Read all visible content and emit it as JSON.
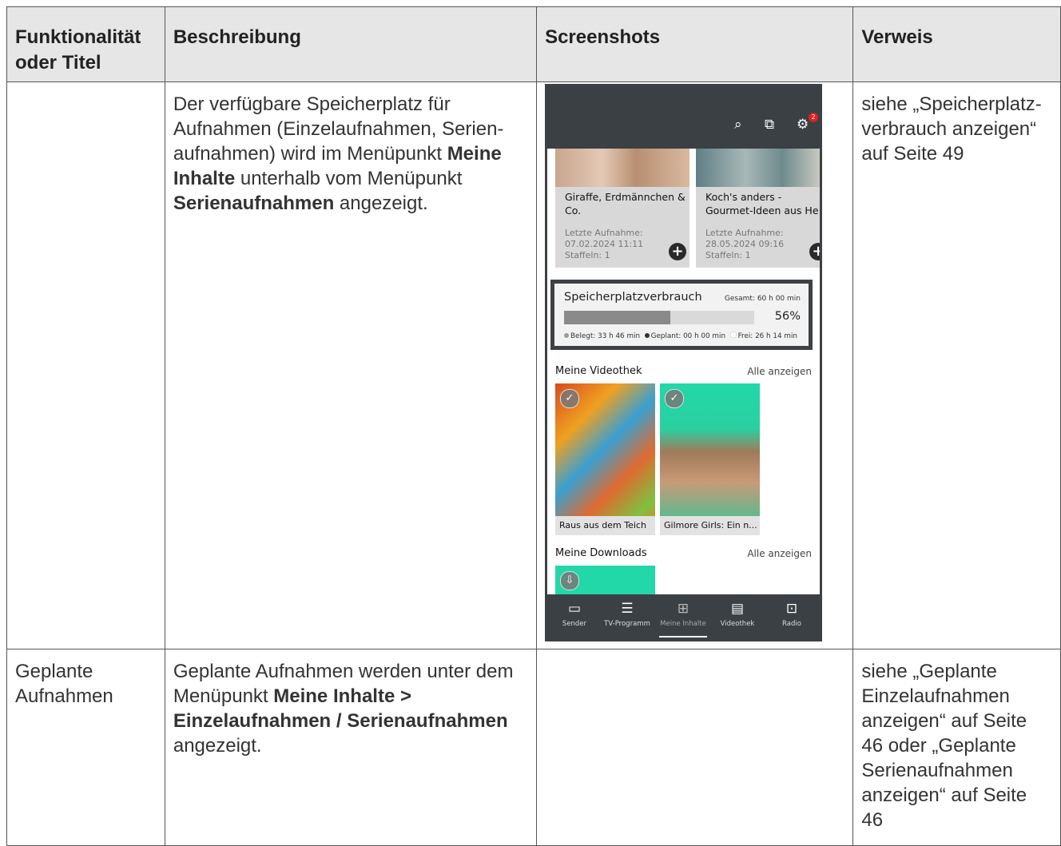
{
  "table": {
    "headers": [
      "Funktionalität oder Titel",
      "Beschreibung",
      "Screenshots",
      "Verweis"
    ],
    "row1": {
      "title": "",
      "desc_1": "Der verfügbare Speicherplatz für Aufnahmen (Einzelaufnahmen, Serien-aufnahmen) wird im Menüpunkt ",
      "desc_b1": "Meine Inhalte",
      "desc_2": " unterhalb vom Menüpunkt ",
      "desc_b2": "Serienaufnahmen",
      "desc_3": " angezeigt.",
      "ref": "siehe „Speicherplatz-verbrauch anzeigen“ auf Seite 49"
    },
    "row2": {
      "title": "Geplante Aufnahmen",
      "desc_1": "Geplante Aufnahmen werden unter dem Menüpunkt ",
      "desc_b1": "Meine Inhalte > Einzelaufnahmen / Serienaufnahmen",
      "desc_2": " angezeigt.",
      "ref": "siehe „Geplante Einzelaufnahmen anzeigen“ auf Seite 46 oder „Geplante Serienaufnahmen anzeigen“ auf Seite 46"
    }
  },
  "phone": {
    "header_icons": [
      "search-icon",
      "devices-icon",
      "gear-icon"
    ],
    "settings_badge": "2",
    "cards": [
      {
        "title_1": "Giraffe, Erdmännchen &",
        "title_2": "Co.",
        "meta_1": "Letzte Aufnahme:",
        "meta_2": "07.02.2024 11:11",
        "meta_3": "Staffeln: 1"
      },
      {
        "title_1": "Koch's anders -",
        "title_2": "Gourmet-Ideen aus He",
        "meta_1": "Letzte Aufnahme:",
        "meta_2": "28.05.2024 09:16",
        "meta_3": "Staffeln: 1"
      }
    ],
    "plus_glyph": "+",
    "usage": {
      "title": "Speicherplatzverbrauch",
      "total": "Gesamt: 60 h 00 min",
      "percent_label": "56%",
      "percent_value": 0.56,
      "used": "Belegt: 33 h 46 min",
      "planned": "Geplant: 00 h 00 min",
      "free": "Frei: 26 h 14 min"
    },
    "videothek": {
      "title": "Meine Videothek",
      "all": "Alle anzeigen",
      "tiles": [
        "Raus aus dem Teich",
        "Gilmore Girls: Ein n..."
      ]
    },
    "downloads": {
      "title": "Meine Downloads",
      "all": "Alle anzeigen"
    },
    "check_glyph": "✓",
    "download_glyph": "⇩",
    "nav": [
      {
        "label": "Sender",
        "icon": "tv-icon",
        "glyph": "▭"
      },
      {
        "label": "TV-Programm",
        "icon": "list-icon",
        "glyph": "☰"
      },
      {
        "label": "Meine Inhalte",
        "icon": "grid-plus-icon",
        "glyph": "⊞"
      },
      {
        "label": "Videothek",
        "icon": "film-icon",
        "glyph": "▤"
      },
      {
        "label": "Radio",
        "icon": "radio-icon",
        "glyph": "⊡"
      }
    ],
    "icon_glyphs": {
      "search": "⌕",
      "devices": "⧉",
      "gear": "⚙"
    }
  }
}
